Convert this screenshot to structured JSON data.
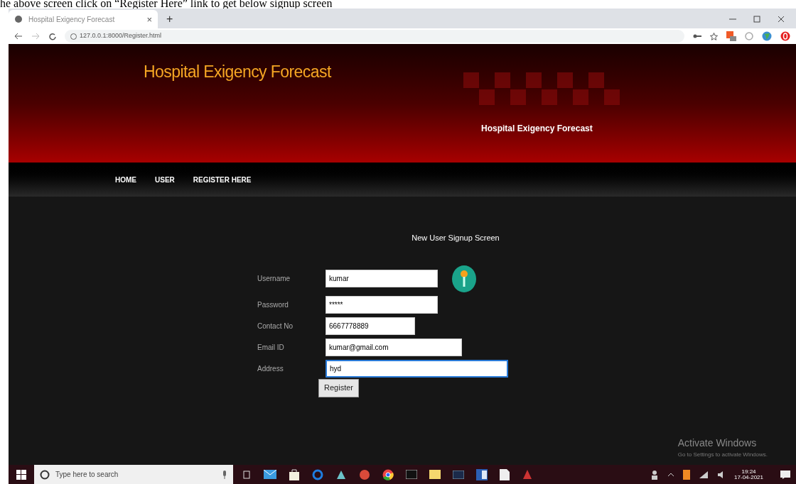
{
  "caption": "he above screen click on “Register Here” link to get below signup screen",
  "browser": {
    "tab_title": "Hospital Exigency Forecast",
    "tab_close": "×",
    "new_tab": "+",
    "address": "127.0.0.1:8000/Register.html"
  },
  "header": {
    "title": "Hospital Exigency Forecast",
    "subtitle": "Hospital Exigency Forecast"
  },
  "nav": [
    {
      "label": "HOME"
    },
    {
      "label": "USER"
    },
    {
      "label": "REGISTER HERE"
    }
  ],
  "form": {
    "title": "New User Signup Screen",
    "fields": [
      {
        "label": "Username",
        "value": "kumar",
        "focused": false
      },
      {
        "label": "Password",
        "value": "*****",
        "focused": false
      },
      {
        "label": "Contact No",
        "value": "6667778889",
        "focused": false
      },
      {
        "label": "Email ID",
        "value": "kumar@gmail.com",
        "focused": false
      },
      {
        "label": "Address",
        "value": "hyd",
        "focused": true
      }
    ],
    "button": "Register"
  },
  "watermark": {
    "title": "Activate Windows",
    "text": "Go to Settings to activate Windows."
  },
  "taskbar": {
    "search_placeholder": "Type here to search",
    "time": "19:24",
    "date": "17-04-2021"
  }
}
